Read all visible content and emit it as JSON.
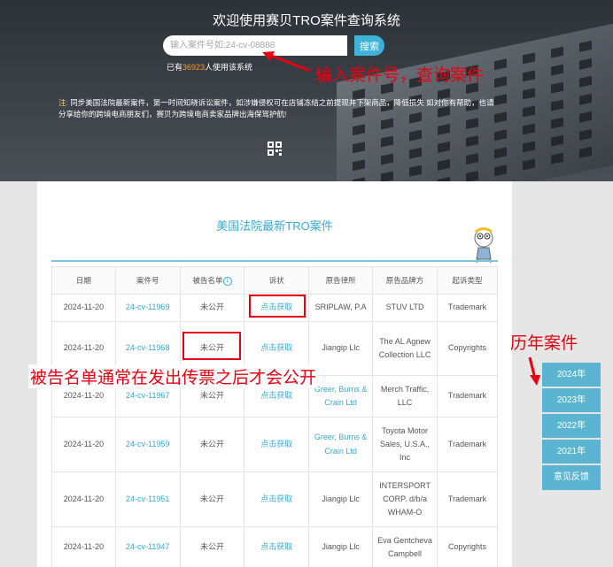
{
  "header": {
    "title": "欢迎使用赛贝TRO案件查询系统",
    "search_placeholder": "输入案件号如:24-cv-08888",
    "search_button": "搜索",
    "user_count_prefix": "已有",
    "user_count": "36923",
    "user_count_suffix": "人使用该系统",
    "notice_label": "注:",
    "notice_text": "同步美国法院最新案件，第一时间知晓诉讼案件，如涉嫌侵权可在店铺冻结之前提现并下架商品，降低损失 如对你有帮助，也请分享给你的跨境电商朋友们，赛贝为跨境电商卖家品牌出海保驾护航!"
  },
  "annotations": {
    "search_hint": "输入案件号，查询案件",
    "defendant_hint": "被告名单通常在发出传票之后才会公开",
    "history_hint": "历年案件"
  },
  "section": {
    "title": "美国法院最新TRO案件"
  },
  "table": {
    "headers": [
      "日期",
      "案件号",
      "被告名单",
      "诉状",
      "原告律所",
      "原告品牌方",
      "起诉类型"
    ],
    "rows": [
      {
        "date": "2024-11-20",
        "case_no": "24-cv-11969",
        "defendants": "未公开",
        "complaint": "点击获取",
        "law_firm": "SRIPLAW, P.A",
        "brand": "STUV LTD",
        "type": "Trademark"
      },
      {
        "date": "2024-11-20",
        "case_no": "24-cv-11968",
        "defendants": "未公开",
        "complaint": "点击获取",
        "law_firm": "Jiangip Llc",
        "brand": "The AL Agnew Collection LLC",
        "type": "Copyrights"
      },
      {
        "date": "2024-11-20",
        "case_no": "24-cv-11967",
        "defendants": "未公开",
        "complaint": "点击获取",
        "law_firm": "Greer, Burns & Crain Ltd",
        "brand": "Merch Traffic, LLC",
        "type": "Trademark"
      },
      {
        "date": "2024-11-20",
        "case_no": "24-cv-11959",
        "defendants": "未公开",
        "complaint": "点击获取",
        "law_firm": "Greer, Burns & Crain Ltd",
        "brand": "Toyota Motor Sales, U.S.A., Inc",
        "type": "Trademark"
      },
      {
        "date": "2024-11-20",
        "case_no": "24-cv-11951",
        "defendants": "未公开",
        "complaint": "点击获取",
        "law_firm": "Jiangip Llc",
        "brand": "INTERSPORT CORP. d/b/a WHAM-O",
        "type": "Trademark"
      },
      {
        "date": "2024-11-20",
        "case_no": "24-cv-11947",
        "defendants": "未公开",
        "complaint": "点击获取",
        "law_firm": "Jiangip Llc",
        "brand": "Eva Gentcheva Campbell",
        "type": "Copyrights"
      }
    ]
  },
  "sidebar": {
    "years": [
      "2024年",
      "2023年",
      "2022年",
      "2021年"
    ],
    "feedback": "意见反馈"
  },
  "colors": {
    "accent": "#3aa9cf",
    "annotation": "#e60012",
    "sidebar": "#5bb5d0",
    "highlight_number": "#ff9a2e"
  }
}
